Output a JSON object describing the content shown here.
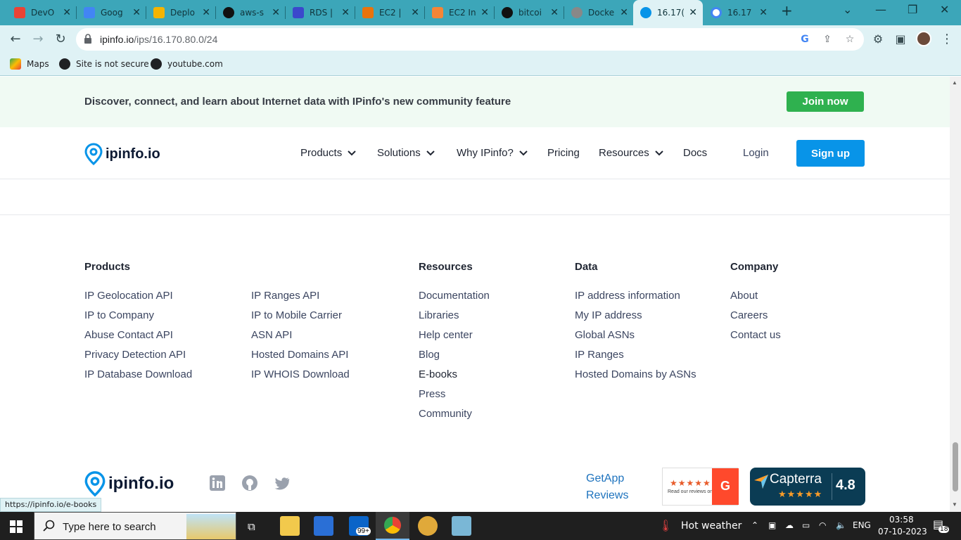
{
  "browser": {
    "tabs": [
      {
        "title": "DevO",
        "favicon": "gmail-icon",
        "color": "#ea4335"
      },
      {
        "title": "Goog",
        "favicon": "google-translate-icon",
        "color": "#4285f4"
      },
      {
        "title": "Deplo",
        "favicon": "aws-deploy-icon",
        "color": "#f5b400"
      },
      {
        "title": "aws-s",
        "favicon": "github-icon",
        "color": "#111111"
      },
      {
        "title": "RDS |",
        "favicon": "aws-rds-icon",
        "color": "#3b48cc"
      },
      {
        "title": "EC2 |",
        "favicon": "aws-ec2-icon",
        "color": "#e8730c"
      },
      {
        "title": "EC2 In",
        "favicon": "aws-ec2-icon",
        "color": "#f58536"
      },
      {
        "title": "bitcoi",
        "favicon": "github-icon",
        "color": "#111111"
      },
      {
        "title": "Docke",
        "favicon": "chatgpt-icon",
        "color": "#888888"
      },
      {
        "title": "16.17(",
        "favicon": "ipinfo-icon",
        "color": "#0894e8",
        "active": true
      },
      {
        "title": "16.17",
        "favicon": "google-icon",
        "color": "#4285f4"
      }
    ],
    "url_host": "ipinfo.io",
    "url_path": "/ips/16.170.80.0/24",
    "bookmarks": [
      "Maps",
      "Site is not secure",
      "youtube.com"
    ],
    "status_url": "https://ipinfo.io/e-books"
  },
  "banner": {
    "message": "Discover, connect, and learn about Internet data with IPinfo's new community feature",
    "cta": "Join now"
  },
  "nav": {
    "logo": "ipinfo.io",
    "items": [
      "Products",
      "Solutions",
      "Why IPinfo?",
      "Pricing",
      "Resources",
      "Docs"
    ],
    "login": "Login",
    "signup": "Sign up"
  },
  "footer": {
    "columns": [
      {
        "heading": "Products",
        "links": [
          "IP Geolocation API",
          "IP to Company",
          "Abuse Contact API",
          "Privacy Detection API",
          "IP Database Download"
        ]
      },
      {
        "heading": "",
        "links": [
          "IP Ranges API",
          "IP to Mobile Carrier",
          "ASN API",
          "Hosted Domains API",
          "IP WHOIS Download"
        ]
      },
      {
        "heading": "Resources",
        "links": [
          "Documentation",
          "Libraries",
          "Help center",
          "Blog",
          "E-books",
          "Press",
          "Community"
        ]
      },
      {
        "heading": "Data",
        "links": [
          "IP address information",
          "My IP address",
          "Global ASNs",
          "IP Ranges",
          "Hosted Domains by ASNs"
        ]
      },
      {
        "heading": "Company",
        "links": [
          "About",
          "Careers",
          "Contact us"
        ]
      }
    ],
    "logo": "ipinfo.io",
    "social": [
      "linkedin-icon",
      "github-icon",
      "twitter-icon"
    ],
    "getapp_alt": "GetApp Reviews",
    "g2_text": "Read our reviews on",
    "capterra_name": "Capterra",
    "capterra_rating": "4.8"
  },
  "taskbar": {
    "search_placeholder": "Type here to search",
    "mail_badge": "99+",
    "weather": "Hot weather",
    "lang": "ENG",
    "time": "03:58",
    "date": "07-10-2023",
    "notifications": "18"
  }
}
